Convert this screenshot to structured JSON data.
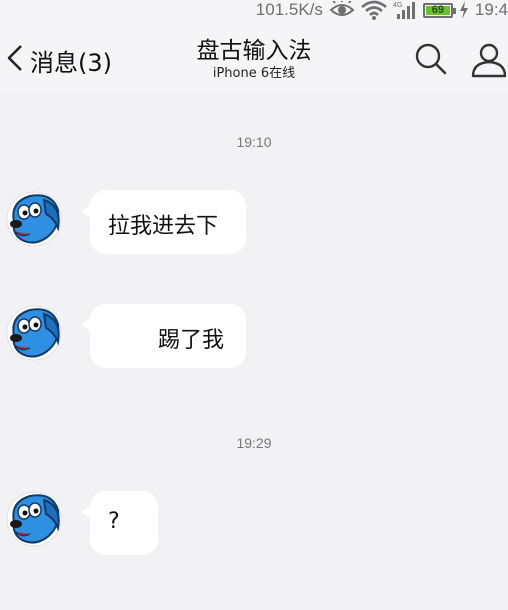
{
  "status_bar": {
    "network_speed": "101.5K/s",
    "network_type": "4G",
    "battery_level": "69",
    "clock": "19:4"
  },
  "header": {
    "back_label": "消息(3)",
    "title": "盘古输入法",
    "subtitle": "iPhone 6在线"
  },
  "messages": {
    "time_1": "19:10",
    "msg_1": "拉我进去下",
    "msg_2": "踢了我",
    "time_2": "19:29",
    "msg_3": "?"
  },
  "colors": {
    "background": "#f2f2f4",
    "bubble": "#ffffff",
    "avatar_blue": "#2f8fe0",
    "battery_green": "#6dbf2a"
  },
  "icons": [
    "eye-icon",
    "wifi-icon",
    "signal-icon",
    "battery-icon",
    "charge-icon",
    "back-chevron-icon",
    "search-icon",
    "contact-icon",
    "dog-avatar"
  ]
}
